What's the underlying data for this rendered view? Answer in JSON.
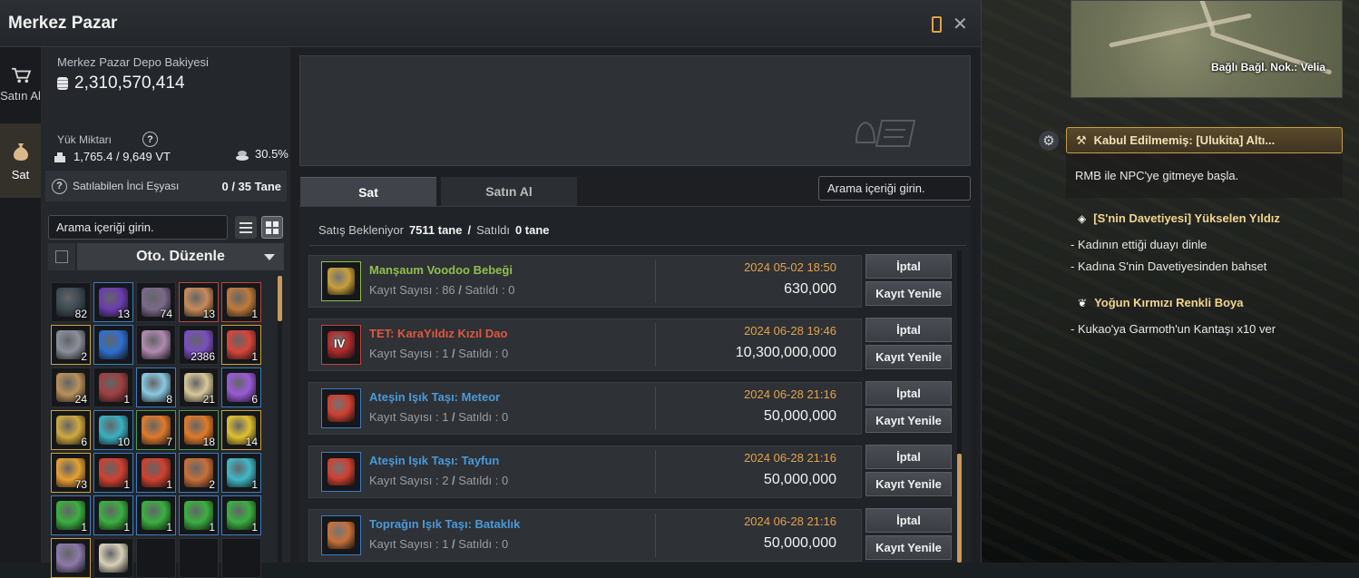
{
  "window": {
    "title": "Merkez Pazar"
  },
  "side_tabs": [
    {
      "label": "Satın Al",
      "icon": "cart-icon",
      "active": false
    },
    {
      "label": "Sat",
      "icon": "money-bag-icon",
      "active": true
    }
  ],
  "balance": {
    "label": "Merkez Pazar Depo Bakiyesi",
    "value": "2,310,570,414"
  },
  "weight": {
    "label": "Yük Miktarı",
    "value": "1,765.4 / 9,649 VT",
    "percent": "30.5%"
  },
  "pearl_items": {
    "label": "Satılabilen İnci Eşyası",
    "count": "0 / 35 Tane"
  },
  "inventory": {
    "search_placeholder": "Arama içeriği girin.",
    "sort_label": "Oto. Düzenle",
    "slots": [
      {
        "qty": "82",
        "color": "#3c4a52",
        "border": "none"
      },
      {
        "qty": "13",
        "color": "#6a3db0",
        "border": "blue"
      },
      {
        "qty": "74",
        "color": "#7a6a8a",
        "border": "none"
      },
      {
        "qty": "13",
        "color": "#c88a5a",
        "border": "red"
      },
      {
        "qty": "1",
        "color": "#c07a3a",
        "border": "red"
      },
      {
        "qty": "2",
        "color": "#8b8f99",
        "border": "gold"
      },
      {
        "qty": "",
        "color": "#2d6fd0",
        "border": "blue"
      },
      {
        "qty": "",
        "color": "#b08ab0",
        "border": "none"
      },
      {
        "qty": "2386",
        "color": "#7a4fc0",
        "border": "none"
      },
      {
        "qty": "1",
        "color": "#d8453a",
        "border": "gold"
      },
      {
        "qty": "24",
        "color": "#b8905a",
        "border": "none"
      },
      {
        "qty": "1",
        "color": "#a04040",
        "border": "none"
      },
      {
        "qty": "8",
        "color": "#8ac8e0",
        "border": "blue"
      },
      {
        "qty": "21",
        "color": "#d8c89a",
        "border": "none"
      },
      {
        "qty": "6",
        "color": "#9a5ad8",
        "border": "blue"
      },
      {
        "qty": "6",
        "color": "#d0a840",
        "border": "gold"
      },
      {
        "qty": "10",
        "color": "#3ab0c0",
        "border": "blue"
      },
      {
        "qty": "7",
        "color": "#e07a2a",
        "border": "green"
      },
      {
        "qty": "18",
        "color": "#e07a2a",
        "border": "green"
      },
      {
        "qty": "14",
        "color": "#e0c030",
        "border": "gold"
      },
      {
        "qty": "73",
        "color": "#e8a030",
        "border": "gold"
      },
      {
        "qty": "1",
        "color": "#d04030",
        "border": "blue"
      },
      {
        "qty": "1",
        "color": "#d04030",
        "border": "blue"
      },
      {
        "qty": "2",
        "color": "#c8703a",
        "border": "blue"
      },
      {
        "qty": "1",
        "color": "#40b8c8",
        "border": "blue"
      },
      {
        "qty": "1",
        "color": "#3ab040",
        "border": "blue"
      },
      {
        "qty": "1",
        "color": "#3ab040",
        "border": "blue"
      },
      {
        "qty": "1",
        "color": "#3ab040",
        "border": "blue"
      },
      {
        "qty": "1",
        "color": "#3ab040",
        "border": "blue"
      },
      {
        "qty": "1",
        "color": "#3ab040",
        "border": "blue"
      },
      {
        "qty": "",
        "color": "#8a7aa8",
        "border": "gold"
      },
      {
        "qty": "",
        "color": "#d8d0b8",
        "border": "none"
      },
      {
        "qty": "",
        "color": "",
        "border": "none"
      },
      {
        "qty": "",
        "color": "",
        "border": "none"
      },
      {
        "qty": "",
        "color": "",
        "border": "none"
      }
    ]
  },
  "tabs": {
    "sell": "Sat",
    "buy": "Satın Al"
  },
  "right_search_placeholder": "Arama içeriği girin.",
  "status": {
    "pending_label": "Satış Bekleniyor",
    "pending_value": "7511 tane",
    "sep": "/",
    "sold_label": "Satıldı",
    "sold_value": "0 tane"
  },
  "listings": [
    {
      "name": "Manşaum Voodoo Bebeği",
      "name_color": "#8fc04a",
      "registered": "Kayıt Sayısı : 86",
      "sold": "Satıldı : 0",
      "date": "2024 05-02 18:50",
      "price": "630,000",
      "icon_color": "#c8a03a",
      "border": "#8fc04a",
      "tag": ""
    },
    {
      "name": "TET: KaraYıldız Kızıl Dao",
      "name_color": "#e0573f",
      "registered": "Kayıt Sayısı : 1",
      "sold": "Satıldı : 0",
      "date": "2024 06-28 19:46",
      "price": "10,300,000,000",
      "icon_color": "#b02a2a",
      "border": "#c0453a",
      "tag": "IV"
    },
    {
      "name": "Ateşin Işık Taşı: Meteor",
      "name_color": "#4a9ad8",
      "registered": "Kayıt Sayısı : 1",
      "sold": "Satıldı : 0",
      "date": "2024 06-28 21:16",
      "price": "50,000,000",
      "icon_color": "#d04030",
      "border": "#3b7cc2",
      "tag": ""
    },
    {
      "name": "Ateşin Işık Taşı: Tayfun",
      "name_color": "#4a9ad8",
      "registered": "Kayıt Sayısı : 2",
      "sold": "Satıldı : 0",
      "date": "2024 06-28 21:16",
      "price": "50,000,000",
      "icon_color": "#d04030",
      "border": "#3b7cc2",
      "tag": ""
    },
    {
      "name": "Toprağın Işık Taşı: Bataklık",
      "name_color": "#4a9ad8",
      "registered": "Kayıt Sayısı : 1",
      "sold": "Satıldı : 0",
      "date": "2024 06-28 21:16",
      "price": "50,000,000",
      "icon_color": "#c8703a",
      "border": "#3b7cc2",
      "tag": ""
    }
  ],
  "listing_buttons": {
    "cancel": "İptal",
    "renew": "Kayıt Yenile"
  },
  "minimap": {
    "location": "Bağlı Bağl. Nok.: Velia"
  },
  "quests": {
    "accepted": "Kabul Edilmemiş: [Ulukita] Altı...",
    "accepted_desc": "RMB ile NPC'ye gitmeye başla.",
    "q1_title": "[S'nin Davetiyesi] Yükselen Yıldız",
    "q1_lines": [
      "- Kadının ettiği duayı dinle",
      "- Kadına S'nin Davetiyesinden bahset"
    ],
    "q2_title": "Yoğun Kırmızı Renkli Boya",
    "q2_lines": [
      "- Kukao'ya Garmoth'un Kantaşı x10 ver"
    ]
  }
}
